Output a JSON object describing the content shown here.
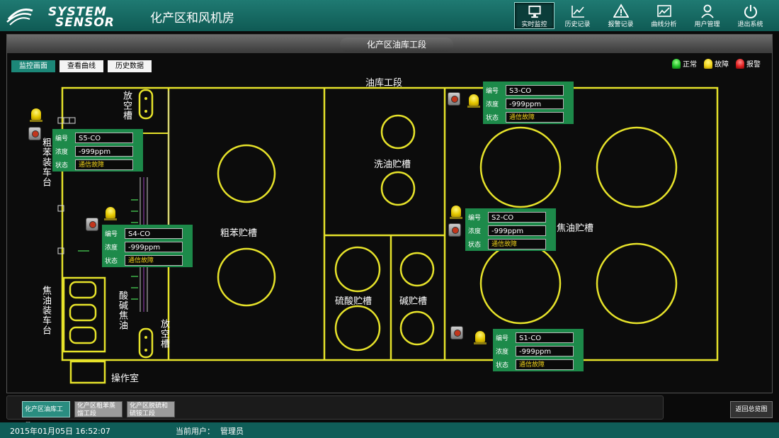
{
  "app": {
    "logo_line1": "SYSTEM",
    "logo_line2": "SENSOR",
    "title": "化产区和风机房"
  },
  "nav": [
    {
      "label": "实时监控",
      "icon": "monitor-icon",
      "active": true
    },
    {
      "label": "历史记录",
      "icon": "history-chart-icon"
    },
    {
      "label": "报警记录",
      "icon": "alarm-warning-icon"
    },
    {
      "label": "曲线分析",
      "icon": "curve-analysis-icon"
    },
    {
      "label": "用户管理",
      "icon": "user-icon"
    },
    {
      "label": "退出系统",
      "icon": "power-icon"
    }
  ],
  "section_title": "化产区油库工段",
  "tabs": [
    "监控画面",
    "查看曲线",
    "历史数据"
  ],
  "legend": [
    {
      "label": "正常",
      "color": "#22c22a"
    },
    {
      "label": "故障",
      "color": "#f0d21a"
    },
    {
      "label": "报警",
      "color": "#e02020"
    }
  ],
  "map": {
    "title": "油库工段",
    "labels": {
      "vent_top": "放空槽",
      "crude_benzene_loading": "粗苯装车台",
      "crude_benzene_tank": "粗苯贮槽",
      "wash_oil_tank": "洗油贮槽",
      "sulfuric_tank": "硫酸贮槽",
      "alkali_tank": "碱贮槽",
      "tar_tank": "焦油贮槽",
      "tar_loading": "焦油装车台",
      "acid_alkali_tar": "酸碱焦油",
      "vent_bottom": "放空槽",
      "control_room": "操作室"
    }
  },
  "sensors": [
    {
      "id": "S5-CO",
      "concentration": "-999ppm",
      "status": "通信故障"
    },
    {
      "id": "S4-CO",
      "concentration": "-999ppm",
      "status": "通信故障"
    },
    {
      "id": "S3-CO",
      "concentration": "-999ppm",
      "status": "通信故障"
    },
    {
      "id": "S2-CO",
      "concentration": "-999ppm",
      "status": "通信故障"
    },
    {
      "id": "S1-CO",
      "concentration": "-999ppm",
      "status": "通信故障"
    }
  ],
  "field_labels": {
    "id": "编号",
    "concentration": "浓度",
    "status": "状态"
  },
  "bottom_tabs": [
    "化产区油库工段",
    "化产区粗苯蒸馏工段",
    "化产区脱硫和硫铵工段"
  ],
  "back_label": "返回总览图",
  "status": {
    "datetime": "2015年01月05日 16:52:07",
    "user_label": "当前用户：",
    "user": "管理员"
  }
}
